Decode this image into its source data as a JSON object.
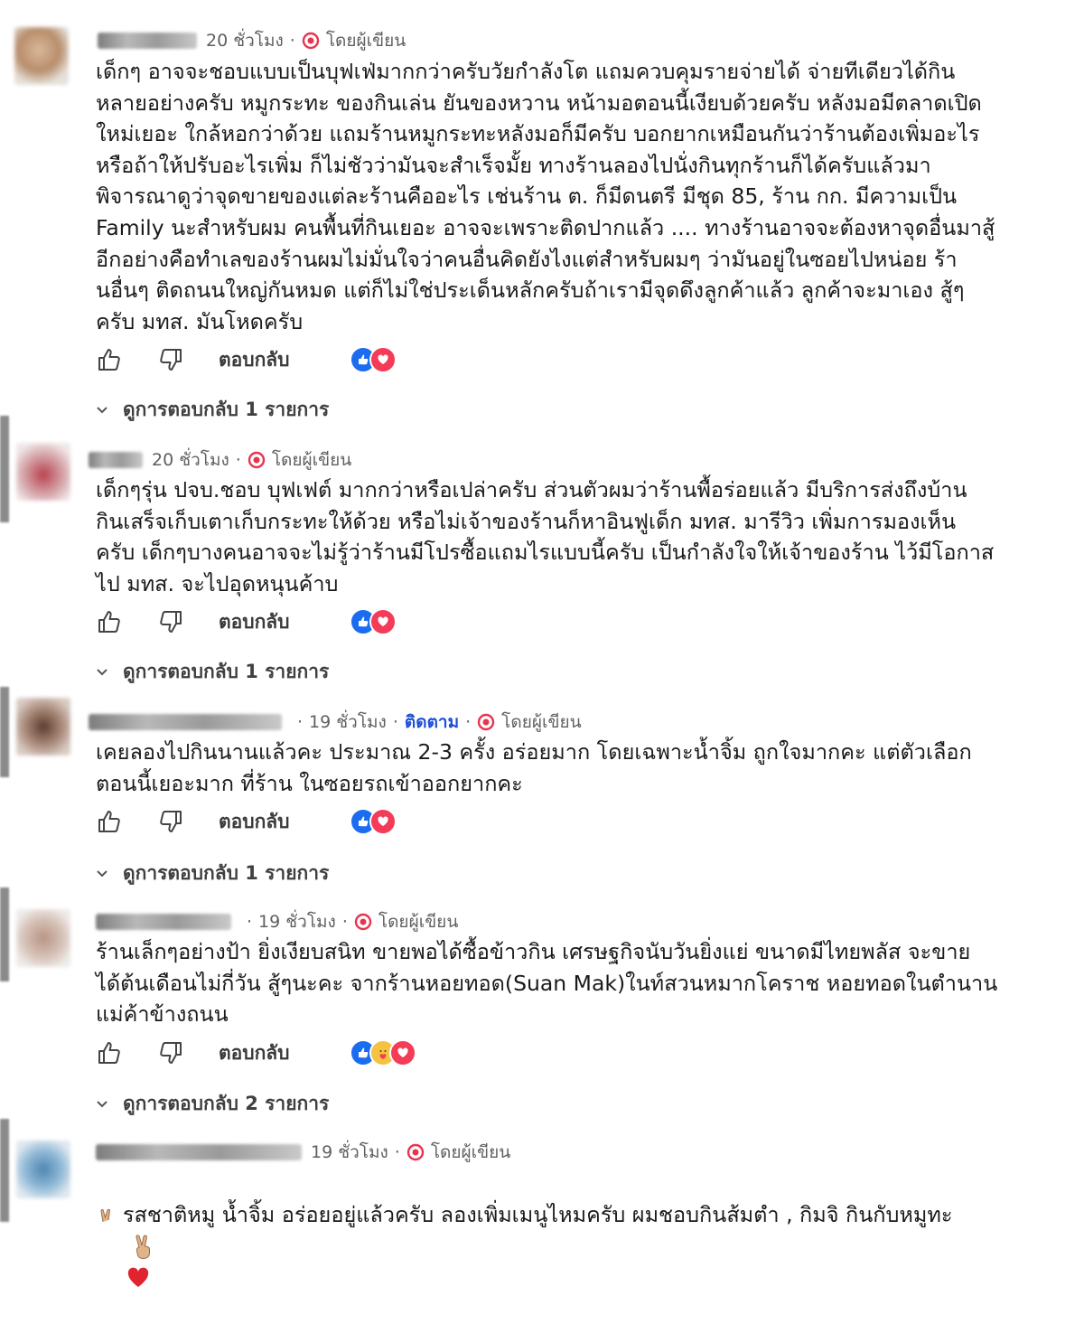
{
  "comments": [
    {
      "time": "20 ชั่วโมง",
      "author_badge": "โดยผู้เขียน",
      "text": "เด็กๆ อาจจะชอบแบบเป็นบุฟเฟ่มากกว่าครับวัยกำลังโต แถมควบคุมรายจ่ายได้ จ่ายทีเดียวได้กิน\nหลายอย่างครับ หมูกระทะ ของกินเล่น ยันของหวาน หน้ามอตอนนี้เงียบด้วยครับ หลังมอมีตลาดเปิด\nใหม่เยอะ ใกล้หอกว่าด้วย แถมร้านหมูกระทะหลังมอก็มีครับ บอกยากเหมือนกันว่าร้านต้องเพิ่มอะไร\nหรือถ้าให้ปรับอะไรเพิ่ม ก็ไม่ชัวว่ามันจะสำเร็จมั้ย ทางร้านลองไปนั่งกินทุกร้านก็ได้ครับแล้วมา\nพิจารณาดูว่าจุดขายของแต่ละร้านคืออะไร เช่นร้าน ต. ก็มีดนตรี มีชุด 85, ร้าน กก. มีความเป็น\nFamily นะสำหรับผม คนพื้นที่กินเยอะ อาจจะเพราะติดปากแล้ว .... ทางร้านอาจจะต้องหาจุดอื่นมาสู้\nอีกอย่างคือทำเลของร้านผมไม่มั่นใจว่าคนอื่นคิดยังไงแต่สำหรับผมๆ ว่ามันอยู่ในซอยไปหน่อย ร้า\nนอื่นๆ ติดถนนใหญ่กันหมด แต่ก็ไม่ใช่ประเด็นหลักครับถ้าเรามีจุดดึงลูกค้าแล้ว ลูกค้าจะมาเอง สู้ๆ\nครับ มทส. มันโหดครับ",
      "reply_label": "ตอบกลับ",
      "view_replies": "ดูการตอบกลับ 1 รายการ",
      "reactions": [
        "like",
        "love"
      ],
      "avatar_color": "#c9a585"
    },
    {
      "time": "20 ชั่วโมง",
      "author_badge": "โดยผู้เขียน",
      "text": "เด็กๆรุ่น ปจบ.ชอบ บุฟเฟต์ มากกว่าหรือเปล่าครับ ส่วนตัวผมว่าร้านพื้อร่อยแล้ว มีบริการส่งถึงบ้าน\nกินเสร็จเก็บเตาเก็บกระทะให้ด้วย หรือไม่เจ้าของร้านก็หาอินฟูเด็ก มทส. มารีวิว เพิ่มการมองเห็น\nครับ เด็กๆบางคนอาจจะไม่รู้ว่าร้านมีโปรซื้อแถมไรแบบนี้ครับ เป็นกำลังใจให้เจ้าของร้าน ไว้มีโอกาส\nไป มทส. จะไปอุดหนุนค้าบ",
      "reply_label": "ตอบกลับ",
      "view_replies": "ดูการตอบกลับ 1 รายการ",
      "reactions": [
        "like",
        "love"
      ],
      "avatar_color": "#b9424f"
    },
    {
      "time": "19 ชั่วโมง",
      "follow": "ติดตาม",
      "author_badge": "โดยผู้เขียน",
      "text": "เคยลองไปกินนานแล้วคะ ประมาณ 2-3 ครั้ง อร่อยมาก โดยเฉพาะน้ำจิ้ม ถูกใจมากคะ แต่ตัวเลือก\nตอนนี้เยอะมาก ที่ร้าน ในซอยรถเข้าออกยากคะ",
      "reply_label": "ตอบกลับ",
      "view_replies": "ดูการตอบกลับ 1 รายการ",
      "reactions": [
        "like",
        "love"
      ],
      "avatar_color": "#7a5a4a"
    },
    {
      "time": "19 ชั่วโมง",
      "author_badge": "โดยผู้เขียน",
      "text": "ร้านเล็กๆอย่างป้า ยิ่งเงียบสนิท ขายพอได้ซื้อข้าวกิน เศรษฐกิจนับวันยิ่งแย่ ขนาดมีไทยพลัส จะขาย\nได้ต้นเดือนไม่กี่วัน สู้ๆนะคะ จากร้านหอยทอด(Suan Mak)ในท์สวนหมากโคราช หอยทอดในตำนาน\nแม่ค้าข้างถนน",
      "reply_label": "ตอบกลับ",
      "view_replies": "ดูการตอบกลับ 2 รายการ",
      "reactions": [
        "like",
        "care",
        "love"
      ],
      "avatar_color": "#c4a99a"
    },
    {
      "time": "19 ชั่วโมง",
      "author_badge": "โดยผู้เขียน",
      "text": "รสชาติหมู น้ำจิ้ม อร่อยอยู่แล้วครับ ลองเพิ่มเมนูไหมครับ ผมชอบกินส้มตำ , กิมจิ กินกับหมูทะ",
      "emojis": [
        "victory-hand-emoji",
        "red-heart-emoji"
      ],
      "avatar_color": "#6f9fc4"
    }
  ]
}
